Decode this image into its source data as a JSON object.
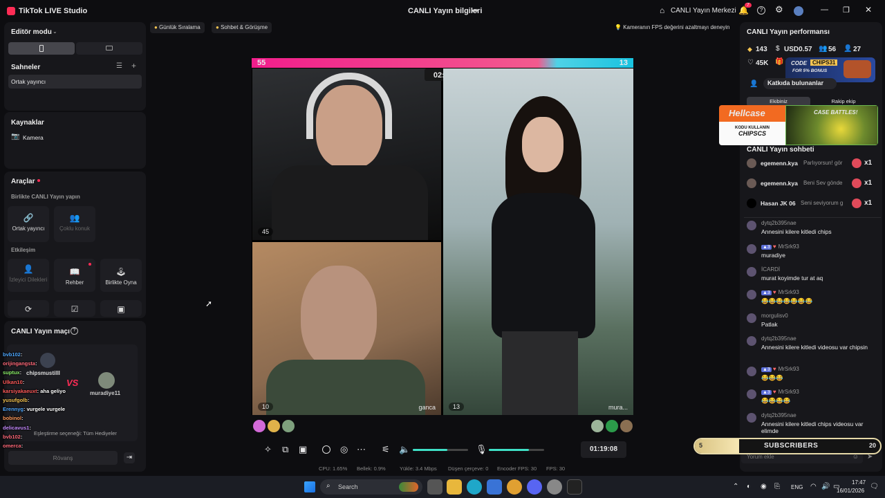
{
  "app": {
    "title": "TikTok LIVE Studio",
    "window_title": "CANLI Yayın bilgileri",
    "center_btn": "CANLI Yayın Merkezi",
    "notif_count": "7"
  },
  "left": {
    "editor_mode": "Editör modu",
    "scenes": "Sahneler",
    "scene_item": "Ortak yayıncı",
    "sources": "Kaynaklar",
    "source_item": "Kamera",
    "tools": "Araçlar",
    "cohost_section": "Birlikte CANLI Yayın yapın",
    "btn_cohost": "Ortak yayıncı",
    "btn_multi": "Çoklu konuk",
    "interaction": "Etkileşim",
    "btn_viewer": "İzleyici Dilekleri",
    "btn_guide": "Rehber",
    "btn_play": "Birlikte Oyna",
    "match": "CANLI Yayın maçı",
    "rematch": "Rövanş",
    "match_setting": "Eşleştirme seçeneği: Tüm Hediyeler",
    "p1": "chipsmustilll",
    "p2": "muradiye11",
    "vs": "VS"
  },
  "top_chips": {
    "daily": "Günlük Sıralama",
    "chat": "Sohbet & Görüşme",
    "tip": "Kameranın FPS değerini azaltmayı deneyin"
  },
  "battle": {
    "left_score": "55",
    "right_score": "13",
    "timer": "02:23"
  },
  "tiles": {
    "t1": "45",
    "t2": "10",
    "t2name": "ganca",
    "t3": "13",
    "t3name": "mura..."
  },
  "controls": {
    "elapsed": "01:19:08"
  },
  "stats": {
    "cpu": "CPU: 1.65%",
    "mem": "Bellek: 0.9%",
    "upload": "Yükle: 3.4 Mbps",
    "drop": "Düşen çerçeve: 0",
    "enc": "Encoder FPS: 30",
    "fps": "FPS: 30"
  },
  "right": {
    "perf": "CANLI Yayın performansı",
    "coins": "143",
    "usd": "USD0.57",
    "viewers": "56",
    "new": "27",
    "likes": "45K",
    "contrib": "Katkıda bulunanlar",
    "our_team": "Ekibiniz",
    "rival_team": "Rakip ekip",
    "chat_title": "CANLI Yayın sohbeti",
    "comment_ph": "Yorum ekle"
  },
  "gifts": [
    {
      "u": "egemenn.kya",
      "m": "Parlıyorsun! gör",
      "x": "x1"
    },
    {
      "u": "egemenn.kya",
      "m": "Beni Sev gönde",
      "x": "x1"
    },
    {
      "u": "Hasan JK 06",
      "m": "Seni seviyorum g",
      "x": "x1"
    }
  ],
  "chat": [
    {
      "u": "dytq2b395nae",
      "m": "Annesini kilere kitledi chips"
    },
    {
      "u": "MrSrk93",
      "m": "muradiye"
    },
    {
      "u": "İCARDİ",
      "m": "murat koyimde tur at aq"
    },
    {
      "u": "MrSrk93",
      "m": "😂😂😂😂😂😂😂"
    },
    {
      "u": "morgulisv0",
      "m": "Patlak"
    },
    {
      "u": "dytq2b395nae",
      "m": "Annesini kilere kitledi videosu var chipsin"
    },
    {
      "u": "MrSrk93",
      "m": "😂😂😂"
    },
    {
      "u": "MrSrk93",
      "m": "😂😂😂😂"
    },
    {
      "u": "dytq2b395nae",
      "m": "Annesini kilere kitledi chips videosu var elimde"
    }
  ],
  "overlay_chat": [
    {
      "u": "bvb102",
      "m": ""
    },
    {
      "u": "orijingangsta",
      "m": ""
    },
    {
      "u": "suptux",
      "m": ""
    },
    {
      "u": "Ulkan10",
      "m": ""
    },
    {
      "u": "karsiyakaeuxt",
      "m": "aha geliyo"
    },
    {
      "u": "yusufgolb",
      "m": ""
    },
    {
      "u": "Erennyg",
      "m": "vurgele vurgele"
    },
    {
      "u": "bobinol",
      "m": ""
    },
    {
      "u": "delicavus1",
      "m": ""
    },
    {
      "u": "bvb102",
      "m": ""
    },
    {
      "u": "omerca",
      "m": ""
    }
  ],
  "ads": {
    "code1": "CODE",
    "code_val": "CHIPS31",
    "bonus": "FOR 5% BONUS",
    "hell": "Hellcase",
    "kod": "KODU KULLANIN",
    "chips5": "CHIPSCS",
    "case": "CASE BATTLES!",
    "subs": "SUBSCRIBERS",
    "subs_left": "5",
    "subs_right": "20"
  },
  "taskbar": {
    "search": "Search",
    "lang": "ENG",
    "time": "17:47",
    "date": "16/01/2026"
  }
}
